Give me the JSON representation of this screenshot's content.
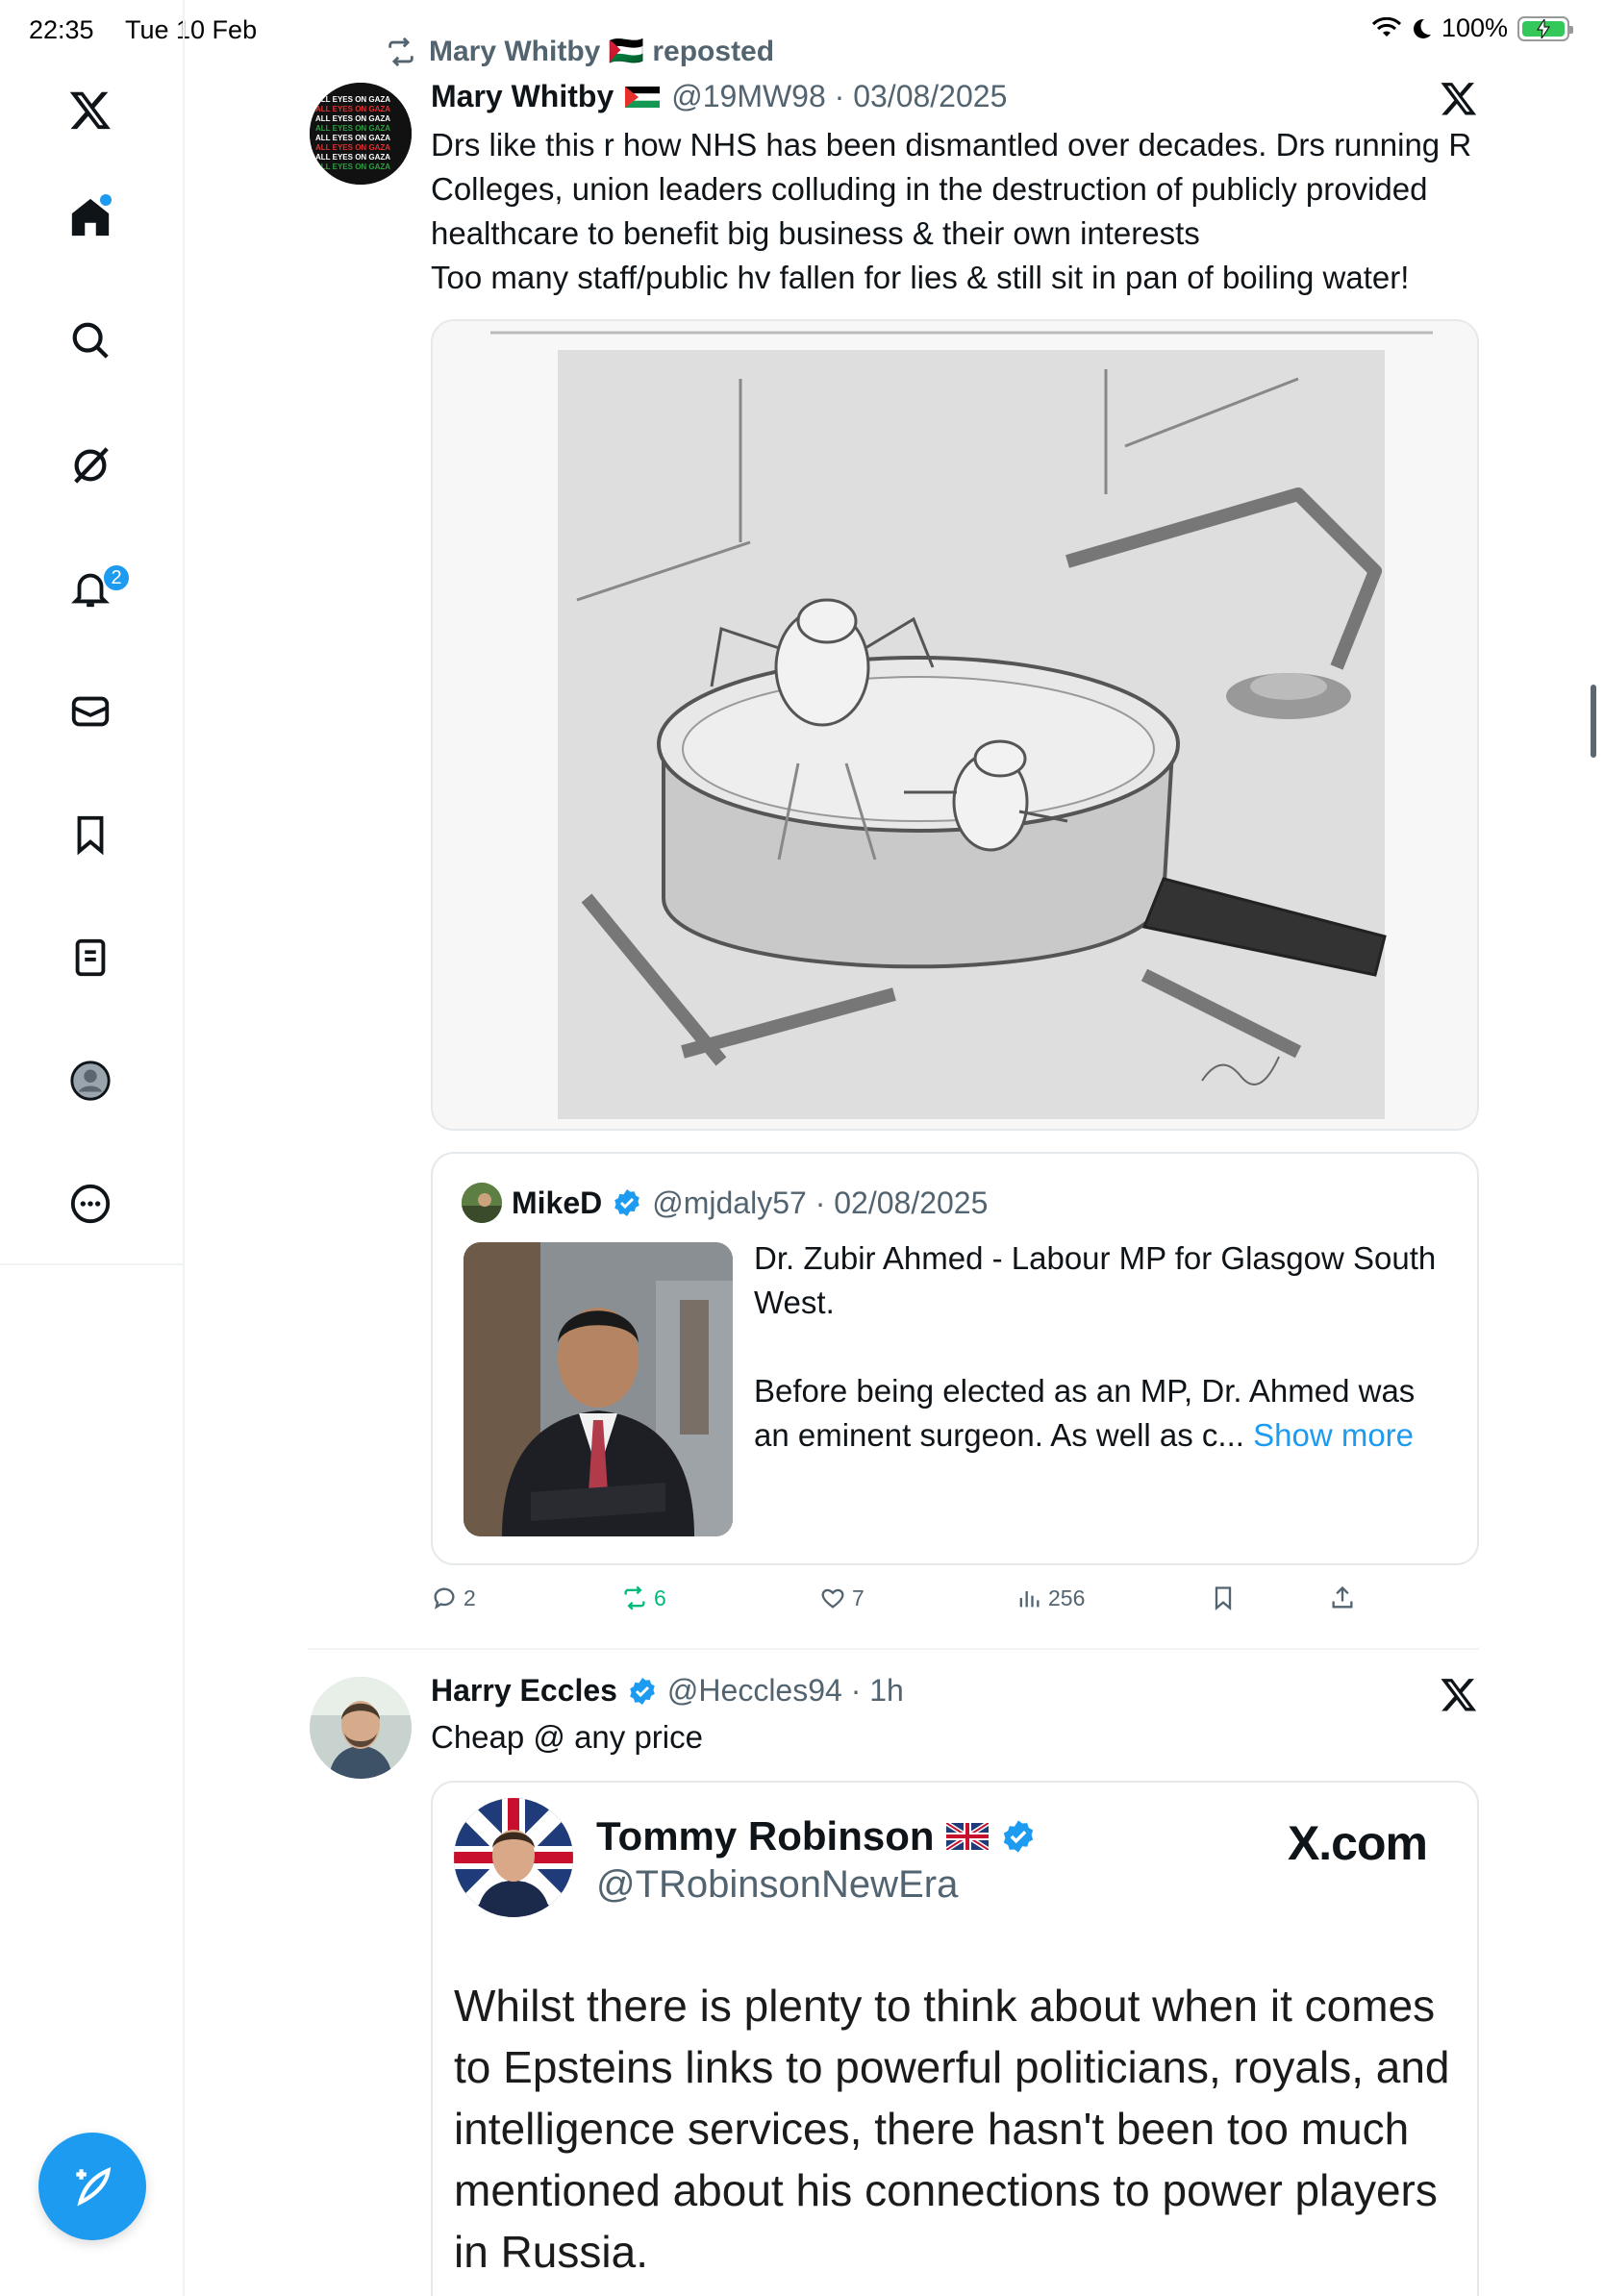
{
  "status_bar": {
    "time": "22:35",
    "date": "Tue 10 Feb",
    "battery": "100%"
  },
  "sidebar": {
    "items": [
      {
        "name": "x-logo",
        "label": "X"
      },
      {
        "name": "home",
        "label": "Home"
      },
      {
        "name": "search",
        "label": "Explore"
      },
      {
        "name": "grok",
        "label": "Grok"
      },
      {
        "name": "notifications",
        "label": "Notifications",
        "badge": "2"
      },
      {
        "name": "messages",
        "label": "Messages"
      },
      {
        "name": "bookmarks",
        "label": "Bookmarks"
      },
      {
        "name": "lists",
        "label": "Lists"
      },
      {
        "name": "profile",
        "label": "Profile"
      },
      {
        "name": "more",
        "label": "More"
      }
    ],
    "notif_badge": "2"
  },
  "tweet1": {
    "repost_label": "Mary Whitby 🇵🇸 reposted",
    "name": "Mary Whitby",
    "handle_date": "@19MW98 · 03/08/2025",
    "text": "Drs like this r how NHS has been dismantled over decades. Drs running R Colleges, union leaders colluding in the destruction of publicly provided healthcare to benefit big business & their own interests\nToo many staff/public hv fallen for lies & still sit in pan of boiling water!",
    "quote": {
      "name": "MikeD",
      "handle_date": "@mjdaly57 · 02/08/2025",
      "text": "Dr. Zubir Ahmed - Labour MP for Glasgow South West.",
      "text2": "Before being elected as an MP, Dr. Ahmed was an eminent surgeon. As well as c...",
      "show_more": "Show more"
    },
    "actions": {
      "replies": "2",
      "reposts": "6",
      "likes": "7",
      "views": "256"
    }
  },
  "tweet2": {
    "name": "Harry Eccles",
    "handle_date": "@Heccles94 · 1h",
    "text": "Cheap @ any price",
    "embed": {
      "name": "Tommy Robinson",
      "handle": "@TRobinsonNewEra",
      "brand": "X.com",
      "body": "Whilst there is plenty to think about when it comes to Epsteins links to powerful politicians, royals, and intelligence services, there hasn't been too much mentioned about his connections to power players in Russia."
    }
  },
  "colors": {
    "accent": "#1d9bf0",
    "repost_green": "#00ba7c",
    "muted": "#536471"
  }
}
